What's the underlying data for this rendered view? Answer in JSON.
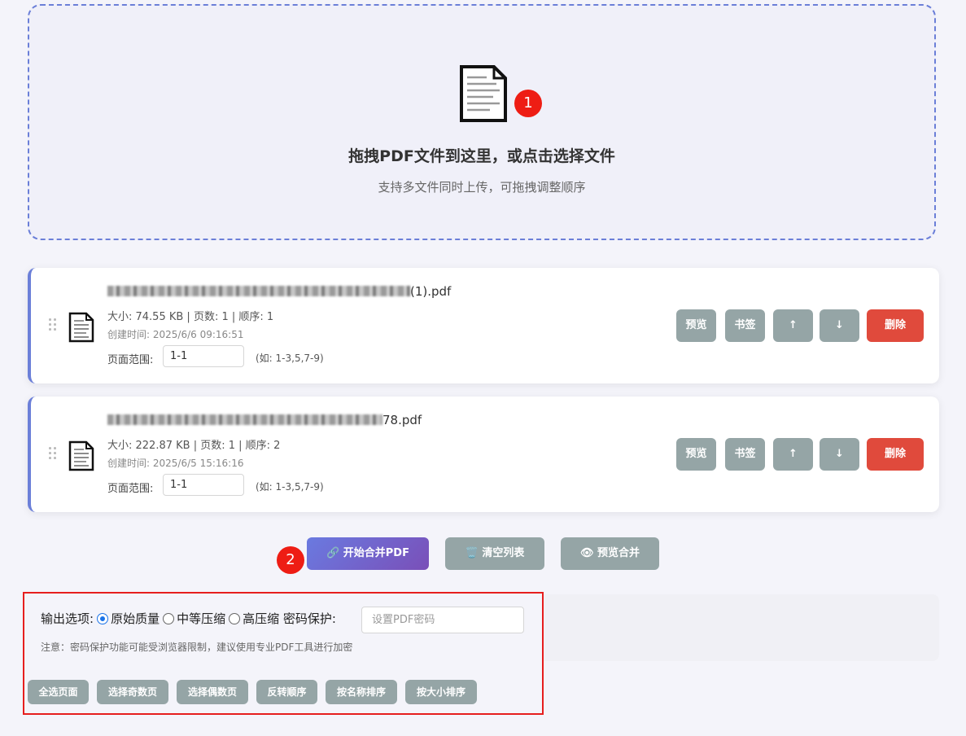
{
  "dropzone": {
    "title": "拖拽PDF文件到这里，或点击选择文件",
    "subtitle": "支持多文件同时上传，可拖拽调整顺序",
    "badge": "1"
  },
  "files": [
    {
      "name_suffix": "(1).pdf",
      "meta": "大小: 74.55 KB | 页数: 1 | 顺序: 1",
      "created": "创建时间: 2025/6/6 09:16:51",
      "range_label": "页面范围:",
      "range_value": "1-1",
      "range_hint": "(如: 1-3,5,7-9)"
    },
    {
      "name_suffix": "78.pdf",
      "meta": "大小: 222.87 KB | 页数: 1 | 顺序: 2",
      "created": "创建时间: 2025/6/5 15:16:16",
      "range_label": "页面范围:",
      "range_value": "1-1",
      "range_hint": "(如: 1-3,5,7-9)"
    }
  ],
  "card_buttons": {
    "preview": "预览",
    "bookmark": "书签",
    "up": "↑",
    "down": "↓",
    "delete": "删除"
  },
  "actions": {
    "badge": "2",
    "merge": "🔗 开始合并PDF",
    "clear": "🗑️ 清空列表",
    "preview_merge": "👁 预览合并"
  },
  "options": {
    "label": "输出选项:",
    "quality_original": "原始质量",
    "quality_medium": "中等压缩",
    "quality_high": "高压缩",
    "password_label": "密码保护:",
    "password_placeholder": "设置PDF密码",
    "note": "注意：密码保护功能可能受浏览器限制，建议使用专业PDF工具进行加密",
    "buttons": {
      "select_all": "全选页面",
      "select_odd": "选择奇数页",
      "select_even": "选择偶数页",
      "reverse": "反转顺序",
      "sort_name": "按名称排序",
      "sort_size": "按大小排序"
    }
  },
  "colors": {
    "accent": "#6b7fd8",
    "gray_button": "#95a5a6",
    "danger": "#e04a3c",
    "badge": "#ee1d14",
    "highlight_border": "#e61e1e"
  }
}
